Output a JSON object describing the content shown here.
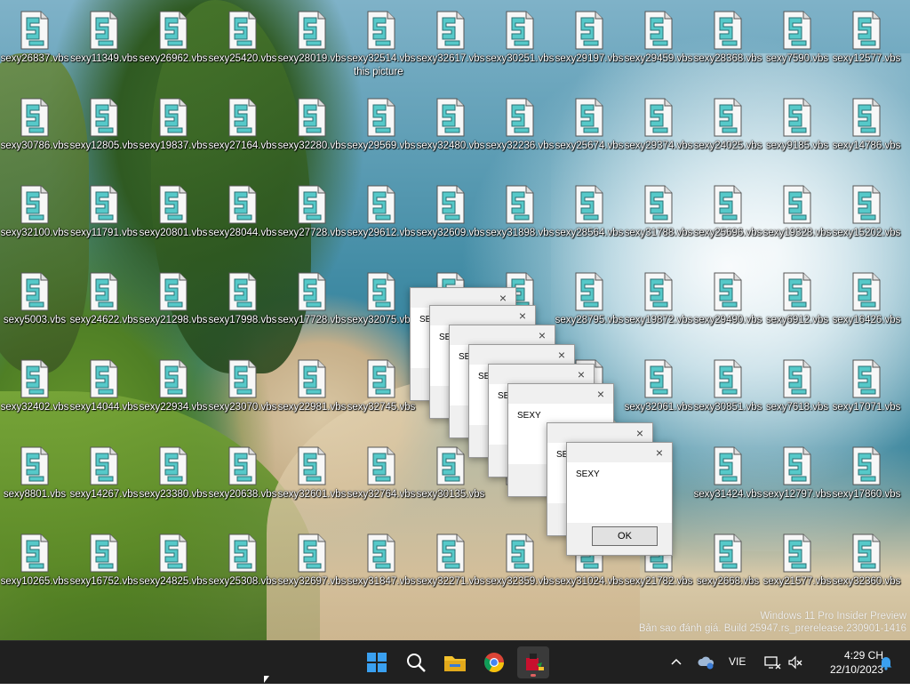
{
  "desktop": {
    "icons": [
      [
        "sexy26837.vbs",
        "sexy11349.vbs",
        "sexy26962.vbs",
        "sexy25420.vbs",
        "sexy28019.vbs",
        "sexy32514.vbs",
        "sexy32617.vbs",
        "sexy30251.vbs",
        "sexy29197.vbs",
        "sexy29459.vbs",
        "sexy28368.vbs",
        "sexy7590.vbs",
        "sexy12577.vbs"
      ],
      [
        "sexy30786.vbs",
        "sexy12805.vbs",
        "sexy19837.vbs",
        "sexy27164.vbs",
        "sexy32280.vbs",
        "sexy29569.vbs",
        "sexy32480.vbs",
        "sexy32236.vbs",
        "sexy25674.vbs",
        "sexy29374.vbs",
        "sexy24025.vbs",
        "sexy9185.vbs",
        "sexy14786.vbs"
      ],
      [
        "sexy32100.vbs",
        "sexy11791.vbs",
        "sexy20801.vbs",
        "sexy28044.vbs",
        "sexy27728.vbs",
        "sexy29612.vbs",
        "sexy32609.vbs",
        "sexy31898.vbs",
        "sexy28564.vbs",
        "sexy31788.vbs",
        "sexy25696.vbs",
        "sexy19328.vbs",
        "sexy15202.vbs"
      ],
      [
        "sexy5003.vbs",
        "sexy24622.vbs",
        "sexy21298.vbs",
        "sexy17998.vbs",
        "sexy17728.vbs",
        "sexy32075.vbs",
        "",
        "",
        "sexy28795.vbs",
        "sexy19872.vbs",
        "sexy29490.vbs",
        "sexy6912.vbs",
        "sexy16426.vbs"
      ],
      [
        "sexy32402.vbs",
        "sexy14044.vbs",
        "sexy22934.vbs",
        "sexy23070.vbs",
        "sexy22981.vbs",
        "sexy32745.vbs",
        "",
        "",
        "",
        "sexy32061.vbs",
        "sexy30851.vbs",
        "sexy7618.vbs",
        "sexy17071.vbs"
      ],
      [
        "sexy8801.vbs",
        "sexy14267.vbs",
        "sexy23380.vbs",
        "sexy20638.vbs",
        "sexy32601.vbs",
        "sexy32764.vbs",
        "sexy30135.vbs",
        "",
        "",
        "",
        "sexy31424.vbs",
        "sexy12797.vbs",
        "sexy17860.vbs"
      ],
      [
        "sexy10265.vbs",
        "sexy16752.vbs",
        "sexy24825.vbs",
        "sexy25308.vbs",
        "sexy32697.vbs",
        "sexy31847.vbs",
        "sexy32271.vbs",
        "sexy32359.vbs",
        "sexy31024.vbs",
        "sexy21782.vbs",
        "sexy2668.vbs",
        "sexy21577.vbs",
        "sexy32360.vbs"
      ]
    ],
    "tooltip_fragment": "this picture",
    "watermark_line1": "Windows 11 Pro Insider Preview",
    "watermark_line2": "Bản sao đánh giá. Build 25947.rs_prerelease.230901-1416"
  },
  "dialogs": {
    "message": "SEXY",
    "ok_label": "OK",
    "close_glyph": "×",
    "partial_labels": [
      "SE",
      "SE",
      "SE",
      "SE",
      "SE",
      "SEXY",
      "SE",
      "SEXY"
    ]
  },
  "taskbar": {
    "language": "VIE",
    "time": "4:29 CH",
    "date": "22/10/2023",
    "apps": [
      "start-icon",
      "search-icon",
      "file-explorer-icon",
      "chrome-icon",
      "wscript-icon"
    ]
  },
  "colors": {
    "taskbar_bg": "#202020",
    "start_blue": "#3aa0f0",
    "folder_yellow": "#f3c12c"
  }
}
